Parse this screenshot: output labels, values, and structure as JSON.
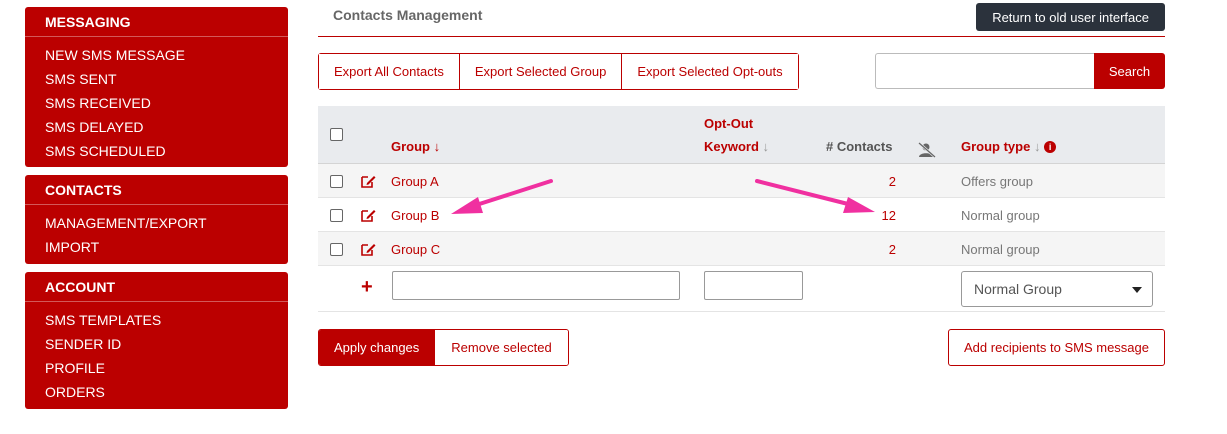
{
  "sidebar": {
    "messaging": {
      "title": "MESSAGING",
      "items": [
        "NEW SMS MESSAGE",
        "SMS SENT",
        "SMS RECEIVED",
        "SMS DELAYED",
        "SMS SCHEDULED"
      ]
    },
    "contacts": {
      "title": "CONTACTS",
      "items": [
        "MANAGEMENT/EXPORT",
        "IMPORT"
      ]
    },
    "account": {
      "title": "ACCOUNT",
      "items": [
        "SMS TEMPLATES",
        "SENDER ID",
        "PROFILE",
        "ORDERS"
      ]
    }
  },
  "header": {
    "title": "Contacts Management",
    "old_ui_label": "Return to old user interface"
  },
  "export": {
    "all": "Export All Contacts",
    "group": "Export Selected Group",
    "optouts": "Export Selected Opt-outs"
  },
  "search": {
    "value": "",
    "button": "Search"
  },
  "table": {
    "headers": {
      "group": "Group",
      "optout_line1": "Opt-Out",
      "optout_line2": "Keyword",
      "contacts": "# Contacts",
      "group_type": "Group type"
    },
    "rows": [
      {
        "group": "Group A",
        "keyword": "",
        "contacts": "2",
        "type": "Offers group"
      },
      {
        "group": "Group B",
        "keyword": "",
        "contacts": "12",
        "type": "Normal group"
      },
      {
        "group": "Group C",
        "keyword": "",
        "contacts": "2",
        "type": "Normal group"
      }
    ],
    "new_row": {
      "group_value": "",
      "keyword_value": "",
      "type_selected": "Normal Group"
    }
  },
  "actions": {
    "apply": "Apply changes",
    "remove": "Remove selected",
    "add_recipients": "Add recipients to SMS message"
  },
  "colors": {
    "brand_red": "#bb0000",
    "dark_button": "#2b323c",
    "annotation_arrow": "#f030a0"
  },
  "icons": [
    "edit-icon",
    "sort-arrow-icon",
    "hide-user-icon",
    "info-icon",
    "plus-icon",
    "chevron-down-icon"
  ]
}
